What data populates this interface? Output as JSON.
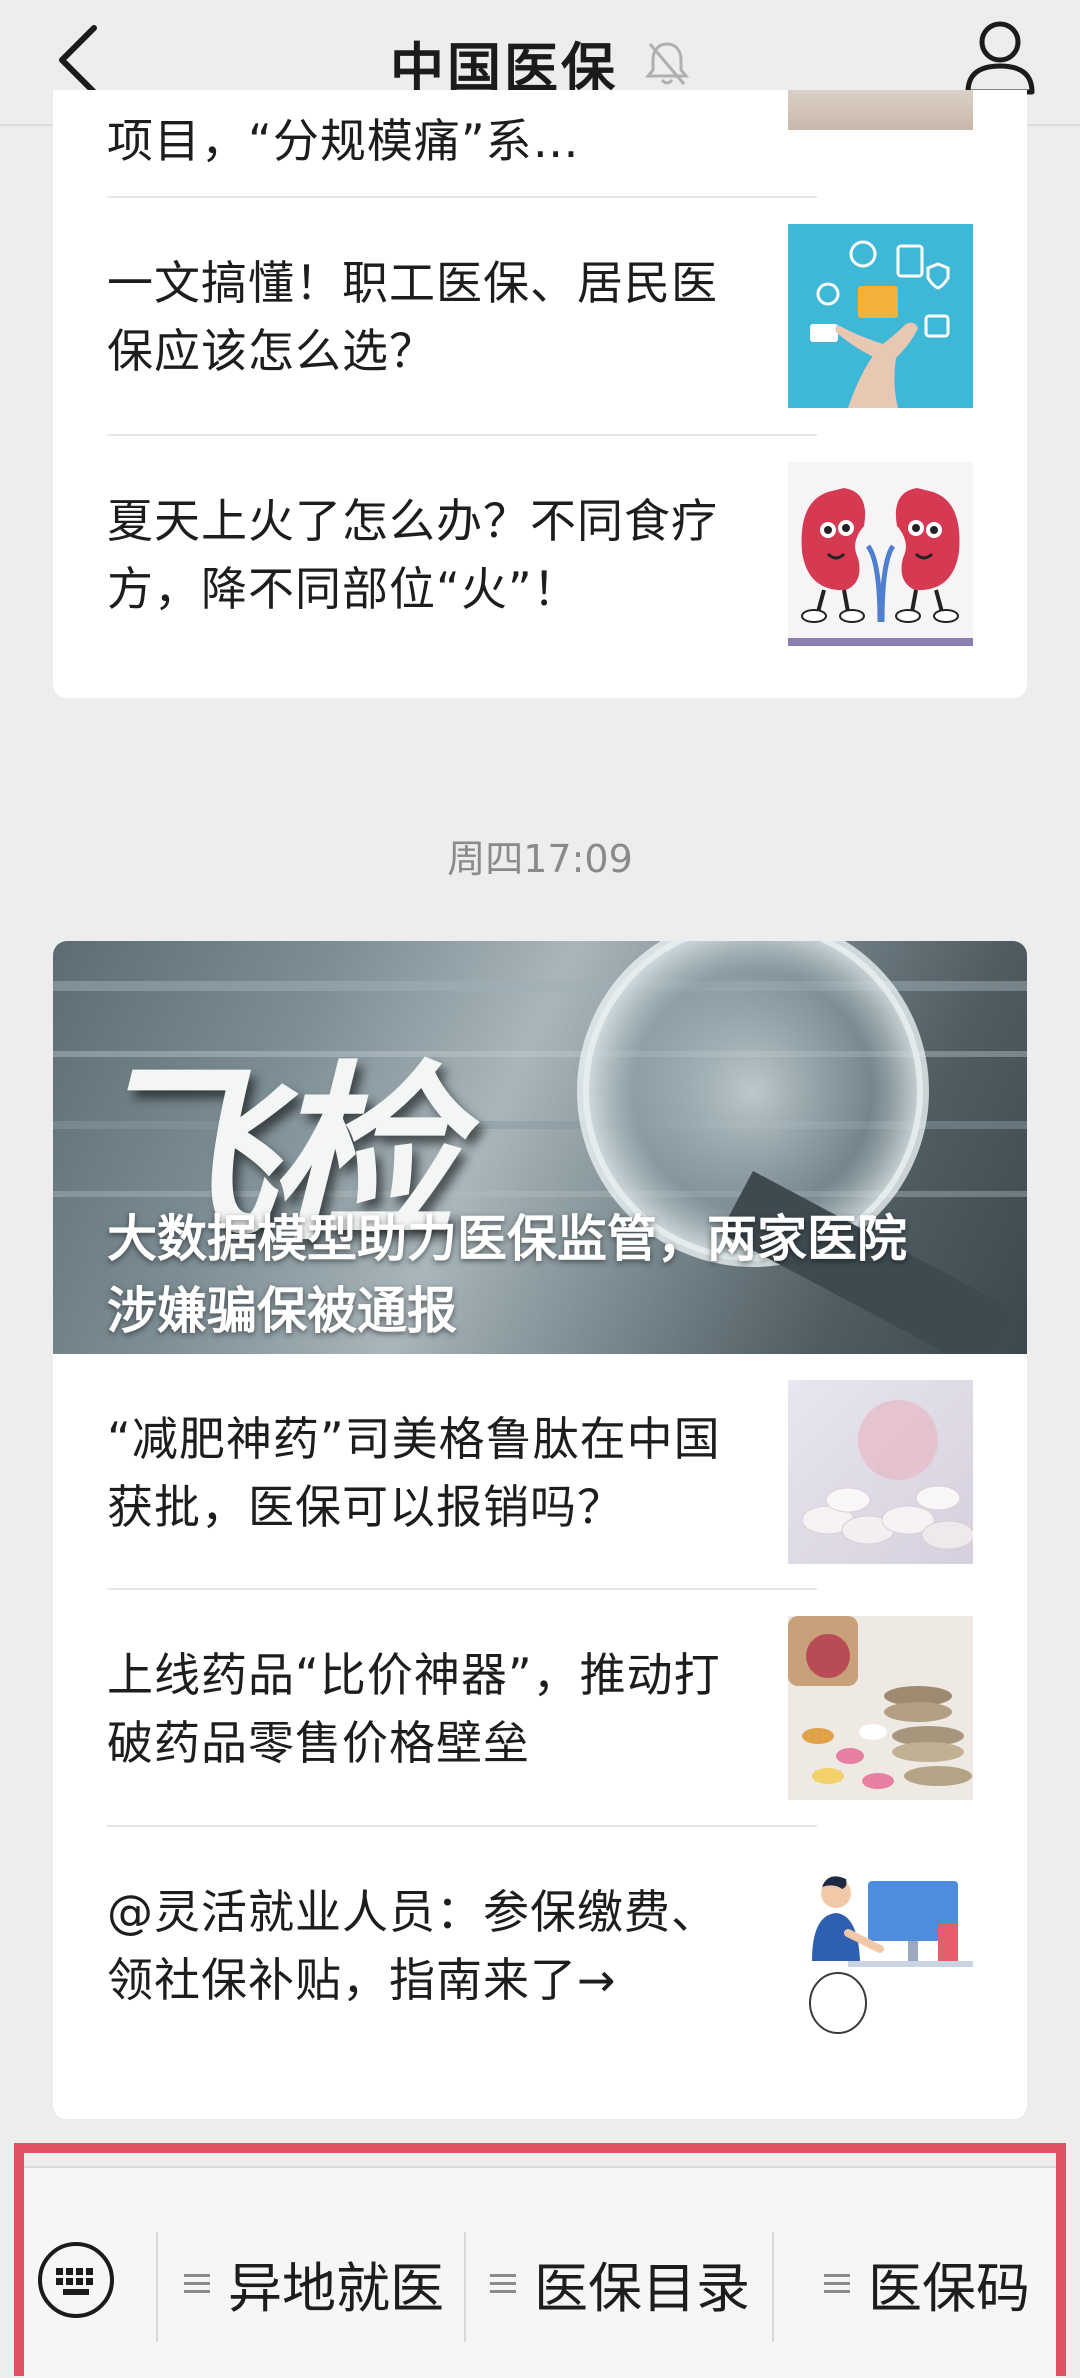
{
  "header": {
    "title": "中国医保",
    "icons": {
      "back": "chevron-left-icon",
      "mute": "bell-muted-icon",
      "profile": "user-icon"
    }
  },
  "top_card": {
    "partial_title": "项目，“分规模痛”系…",
    "items": [
      {
        "title_line1": "一文搞懂！职工医保、居民医",
        "title_line2": "保应该怎么选？",
        "thumb": "hand-with-app-icons"
      },
      {
        "title_line1": "夏天上火了怎么办？不同食疗",
        "title_line2": "方，降不同部位“火”！",
        "thumb": "cartoon-kidneys"
      }
    ]
  },
  "timestamp": "周四17:09",
  "bottom_card": {
    "hero": {
      "graphic_text": "飞检",
      "title_line1": "大数据模型助力医保监管，两家医院",
      "title_line2": "涉嫌骗保被通报"
    },
    "items": [
      {
        "title_line1": "“减肥神药”司美格鲁肽在中国",
        "title_line2": "获批，医保可以报销吗？",
        "thumb": "pills"
      },
      {
        "title_line1": "上线药品“比价神器”，推动打",
        "title_line2": "破药品零售价格壁垒",
        "thumb": "pills-and-coins"
      },
      {
        "title_line1": "@灵活就业人员：参保缴费、",
        "title_line2": "领社保补贴，指南来了→",
        "thumb": "person-at-computer"
      }
    ]
  },
  "menu": {
    "keyboard_icon": "keyboard-icon",
    "items": [
      {
        "label": "异地就医"
      },
      {
        "label": "医保目录"
      },
      {
        "label": "医保码"
      }
    ],
    "highlight_color": "#e25063"
  }
}
